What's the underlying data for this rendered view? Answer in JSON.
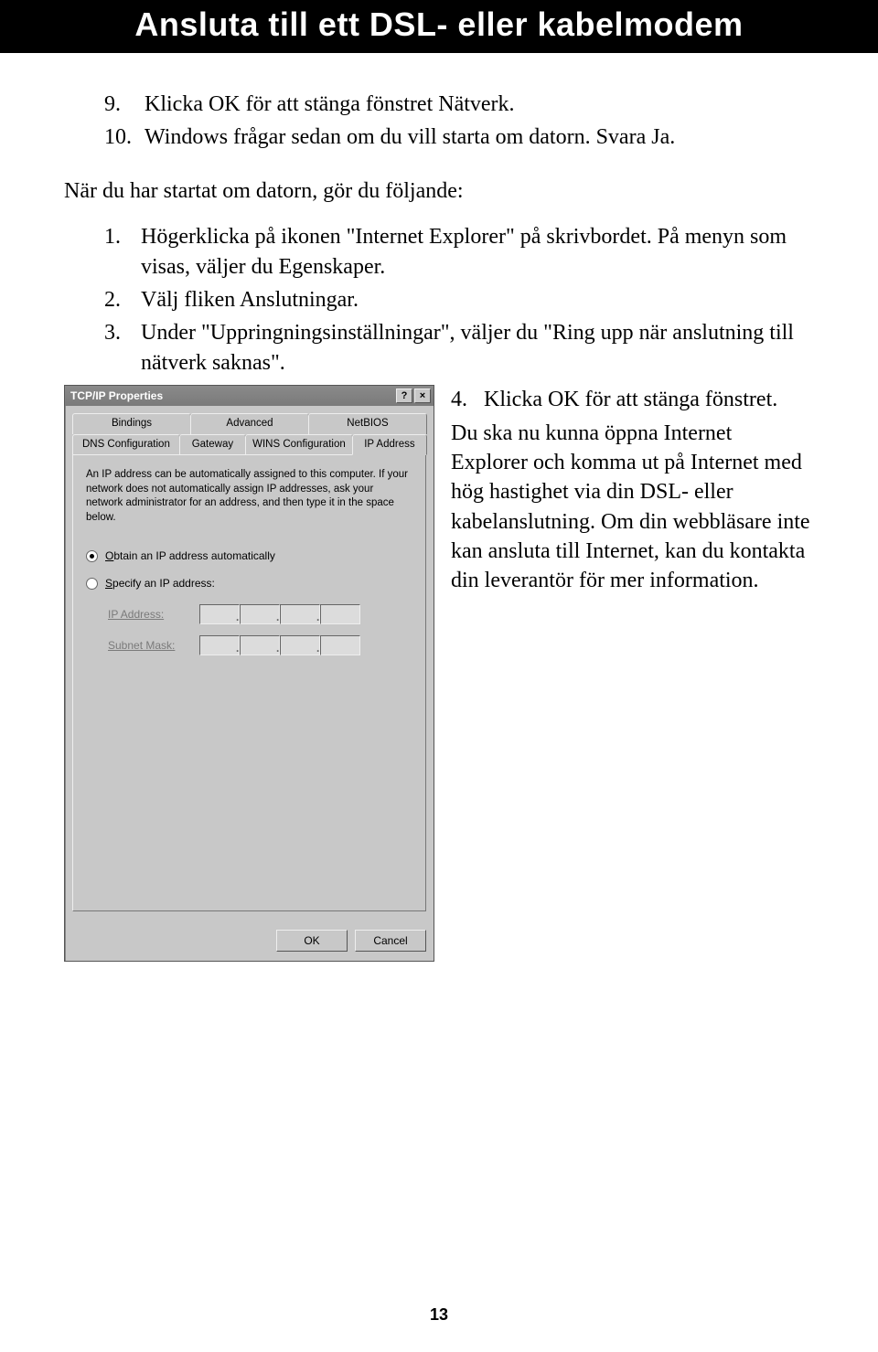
{
  "header": "Ansluta till ett DSL- eller kabelmodem",
  "steps_top": [
    {
      "n": "9.",
      "t": "Klicka OK för att stänga fönstret Nätverk."
    },
    {
      "n": "10.",
      "t": "Windows frågar sedan om du vill starta om datorn. Svara Ja."
    }
  ],
  "after_restart": "När du har startat om datorn, gör du följande:",
  "steps_mid": [
    {
      "n": "1.",
      "t": "Högerklicka på ikonen \"Internet Explorer\" på skrivbordet. På menyn som visas, väljer du Egenskaper."
    },
    {
      "n": "2.",
      "t": "Välj fliken Anslutningar."
    },
    {
      "n": "3.",
      "t": "Under \"Uppringningsinställningar\", väljer du \"Ring upp när anslutning till nätverk saknas\"."
    }
  ],
  "step4": {
    "n": "4.",
    "t": "Klicka OK för att stänga fönstret."
  },
  "final_para": "Du ska nu kunna öppna Internet Explorer och komma ut på Internet med hög hastighet via din DSL- eller kabelanslutning. Om din webbläsare inte kan ansluta till Internet, kan du kontakta din leverantör för mer information.",
  "dialog": {
    "title": "TCP/IP Properties",
    "help": "?",
    "close": "×",
    "tabs_row1": [
      "Bindings",
      "Advanced",
      "NetBIOS"
    ],
    "tabs_row2": [
      "DNS Configuration",
      "Gateway",
      "WINS Configuration",
      "IP Address"
    ],
    "desc": "An IP address can be automatically assigned to this computer. If your network does not automatically assign IP addresses, ask your network administrator for an address, and then type it in the space below.",
    "radio1_pre": "O",
    "radio1_u": "btain an IP address automatically",
    "radio2_pre": "S",
    "radio2_u": "pecify an IP address:",
    "ip_label": "IP Address:",
    "subnet_label": "Subnet Mask:",
    "ok": "OK",
    "cancel": "Cancel"
  },
  "pagenum": "13"
}
